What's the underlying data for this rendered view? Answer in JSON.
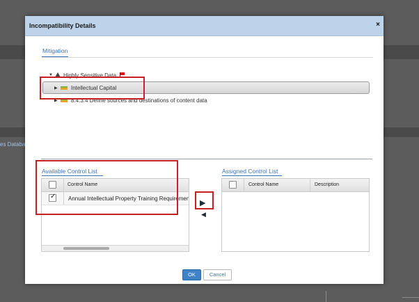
{
  "background": {
    "partial_text": "es Databa"
  },
  "dialog": {
    "title": "Incompatibility Details",
    "close_glyph": "×"
  },
  "tabs": [
    {
      "label": "Mitigation",
      "active": true
    }
  ],
  "tree": {
    "root_label": "Highly Sensitive Data",
    "children": [
      {
        "label": "Intellectual Capital",
        "selected": true
      },
      {
        "label": "8.4.3.4 Define sources and destinations of content data",
        "selected": false
      }
    ]
  },
  "available_controls": {
    "title": "Available Control List",
    "columns": [
      "Control Name"
    ],
    "rows": [
      {
        "name": "Annual Intellectual Property Training Requirement",
        "checked": true
      }
    ]
  },
  "assigned_controls": {
    "title": "Assigned Control List",
    "columns": [
      "Control Name",
      "Description"
    ],
    "rows": []
  },
  "move_buttons": {
    "right_glyph": "▶",
    "left_glyph": "◀"
  },
  "footer": {
    "ok_label": "OK",
    "cancel_label": "Cancel"
  },
  "colors": {
    "accent": "#3b73b9",
    "header": "#bdd3ea",
    "highlight": "#c82020",
    "ok_button": "#3f82c5"
  }
}
